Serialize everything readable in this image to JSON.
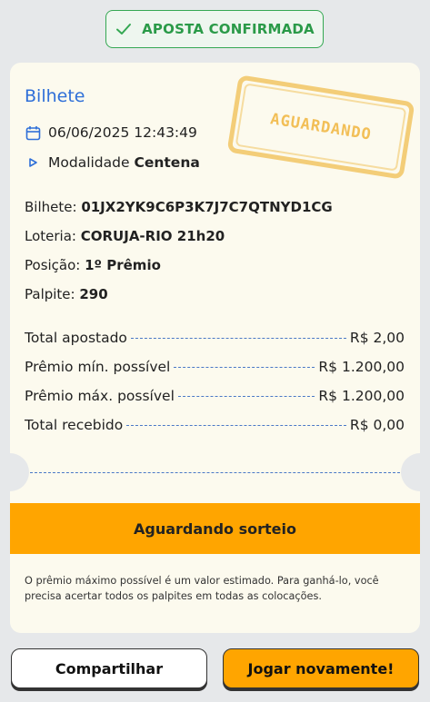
{
  "badge": {
    "label": "APOSTA CONFIRMADA"
  },
  "ticket": {
    "title": "Bilhete",
    "stamp": "AGUARDANDO",
    "datetime": "06/06/2025 12:43:49",
    "modalidade_label": "Modalidade",
    "modalidade_value": "Centena",
    "details": [
      {
        "label": "Bilhete:",
        "value": "01JX2YK9C6P3K7J7C7QTNYD1CG"
      },
      {
        "label": "Loteria:",
        "value": "CORUJA-RIO 21h20"
      },
      {
        "label": "Posição:",
        "value": "1º Prêmio"
      },
      {
        "label": "Palpite:",
        "value": "290"
      }
    ],
    "summary": [
      {
        "label": "Total apostado",
        "value": "R$ 2,00"
      },
      {
        "label": "Prêmio mín. possível",
        "value": "R$ 1.200,00"
      },
      {
        "label": "Prêmio máx. possível",
        "value": "R$ 1.200,00"
      },
      {
        "label": "Total recebido",
        "value": "R$ 0,00"
      }
    ],
    "status": "Aguardando sorteio",
    "disclaimer": "O prêmio máximo possível é um valor estimado. Para ganhá-lo, você precisa acertar todos os palpites em todas as colocações."
  },
  "actions": {
    "share": "Compartilhar",
    "play_again": "Jogar novamente!"
  },
  "colors": {
    "accent_blue": "#2f6fd8",
    "success_green": "#2a9a48",
    "status_orange": "#ffa500",
    "stamp_yellow": "#f0be50"
  }
}
